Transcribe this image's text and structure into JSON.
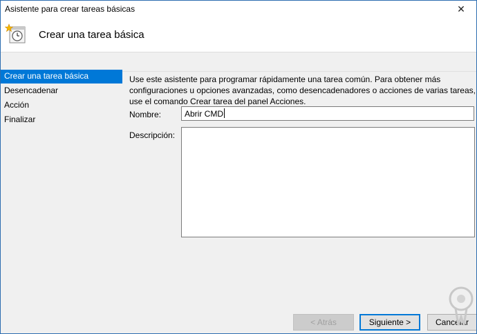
{
  "window": {
    "title": "Asistente para crear tareas básicas",
    "close_glyph": "✕"
  },
  "header": {
    "title": "Crear una tarea básica",
    "icon": "task-scheduler-clock-icon"
  },
  "sidebar": {
    "items": [
      {
        "label": "Crear una tarea básica",
        "active": true
      },
      {
        "label": "Desencadenar",
        "active": false
      },
      {
        "label": "Acción",
        "active": false
      },
      {
        "label": "Finalizar",
        "active": false
      }
    ]
  },
  "main": {
    "intro_lines": [
      "Use este asistente para programar rápidamente una tarea común. Para obtener más",
      "configuraciones u opciones avanzadas, como desencadenadores o acciones de varias tareas,",
      "use el comando Crear tarea del panel Acciones."
    ],
    "name_label": "Nombre:",
    "name_value": "Abrir CMD",
    "description_label": "Descripción:",
    "description_value": ""
  },
  "buttons": {
    "back": "< Atrás",
    "next": "Siguiente >",
    "cancel": "Cancelar"
  },
  "colors": {
    "accent": "#0078d7"
  }
}
